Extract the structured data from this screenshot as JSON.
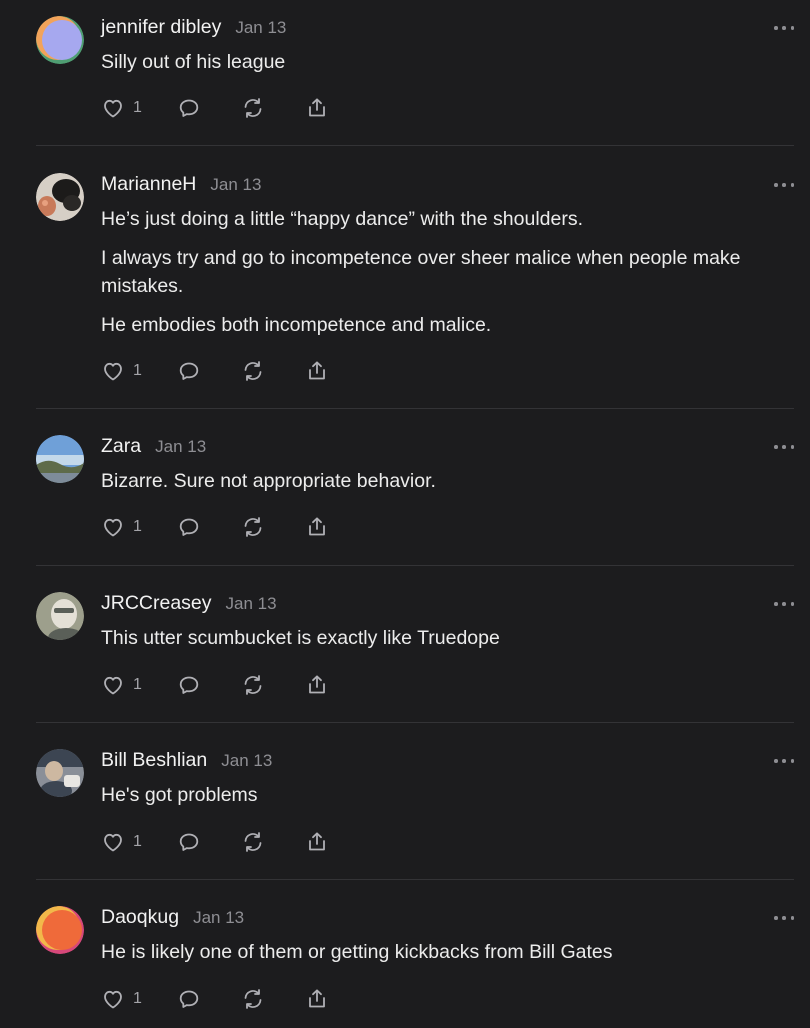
{
  "comments": [
    {
      "author": "jennifer dibley",
      "date": "Jan 13",
      "paragraphs": [
        "Silly out of his league"
      ],
      "likes": "1",
      "avatar": {
        "kind": "gradient",
        "colors": [
          "#f2a35a",
          "#a6a8ef",
          "#4f9e73"
        ]
      }
    },
    {
      "author": "MarianneH",
      "date": "Jan 13",
      "paragraphs": [
        "He’s just doing a little “happy dance” with the shoulders.",
        "I always try and go to incompetence over sheer malice when people make mistakes.",
        "He embodies both incompetence and malice."
      ],
      "likes": "1",
      "avatar": {
        "kind": "photo",
        "colors": [
          "#d6cfc6",
          "#1c1b1a",
          "#c87a5a"
        ]
      }
    },
    {
      "author": "Zara",
      "date": "Jan 13",
      "paragraphs": [
        "Bizarre. Sure not appropriate behavior."
      ],
      "likes": "1",
      "avatar": {
        "kind": "photo",
        "colors": [
          "#6fa0d8",
          "#c3d8ea",
          "#5e6b4a"
        ]
      }
    },
    {
      "author": "JRCCreasey",
      "date": "Jan 13",
      "paragraphs": [
        "This utter scumbucket is exactly like Truedope"
      ],
      "likes": "1",
      "avatar": {
        "kind": "photo",
        "colors": [
          "#9d9f8c",
          "#e4e0d6",
          "#5a5f58"
        ]
      }
    },
    {
      "author": "Bill Beshlian",
      "date": "Jan 13",
      "paragraphs": [
        "He's got problems"
      ],
      "likes": "1",
      "avatar": {
        "kind": "photo",
        "colors": [
          "#8a8f98",
          "#cdb8a1",
          "#3c4552"
        ]
      }
    },
    {
      "author": "Daoqkug",
      "date": "Jan 13",
      "paragraphs": [
        "He is likely one of them or getting kickbacks from Bill Gates"
      ],
      "likes": "1",
      "avatar": {
        "kind": "gradient",
        "colors": [
          "#f2b84a",
          "#ef6a3a",
          "#d6487a"
        ]
      }
    }
  ],
  "icons": [
    "heart-icon",
    "comment-icon",
    "restack-icon",
    "share-icon",
    "more-icon"
  ],
  "colors": {
    "background": "#1c1c1e",
    "text": "#ececec",
    "meta": "#8e8e93",
    "divider": "#333336"
  }
}
